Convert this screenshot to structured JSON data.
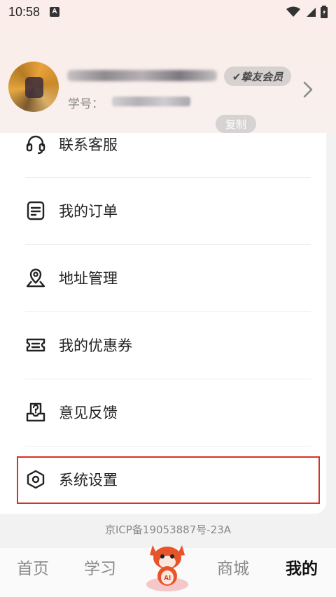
{
  "status_bar": {
    "time": "10:58",
    "notification_letter": "A"
  },
  "profile": {
    "member_badge": "✔挚友会员",
    "student_id_label": "学号：",
    "copy_label": "复制"
  },
  "menu": {
    "items": [
      {
        "label": "联系客服",
        "icon": "headset-icon"
      },
      {
        "label": "我的订单",
        "icon": "order-list-icon"
      },
      {
        "label": "地址管理",
        "icon": "location-pin-icon"
      },
      {
        "label": "我的优惠券",
        "icon": "coupon-icon"
      },
      {
        "label": "意见反馈",
        "icon": "feedback-icon"
      },
      {
        "label": "系统设置",
        "icon": "settings-icon"
      }
    ]
  },
  "footer": {
    "icp": "京ICP备19053887号-23A"
  },
  "tabs": [
    {
      "label": "首页",
      "active": false
    },
    {
      "label": "学习",
      "active": false
    },
    {
      "label": "AI",
      "active": false
    },
    {
      "label": "商城",
      "active": false
    },
    {
      "label": "我的",
      "active": true
    }
  ],
  "colors": {
    "highlight": "#d93025",
    "header_bg": "#fbede9"
  }
}
